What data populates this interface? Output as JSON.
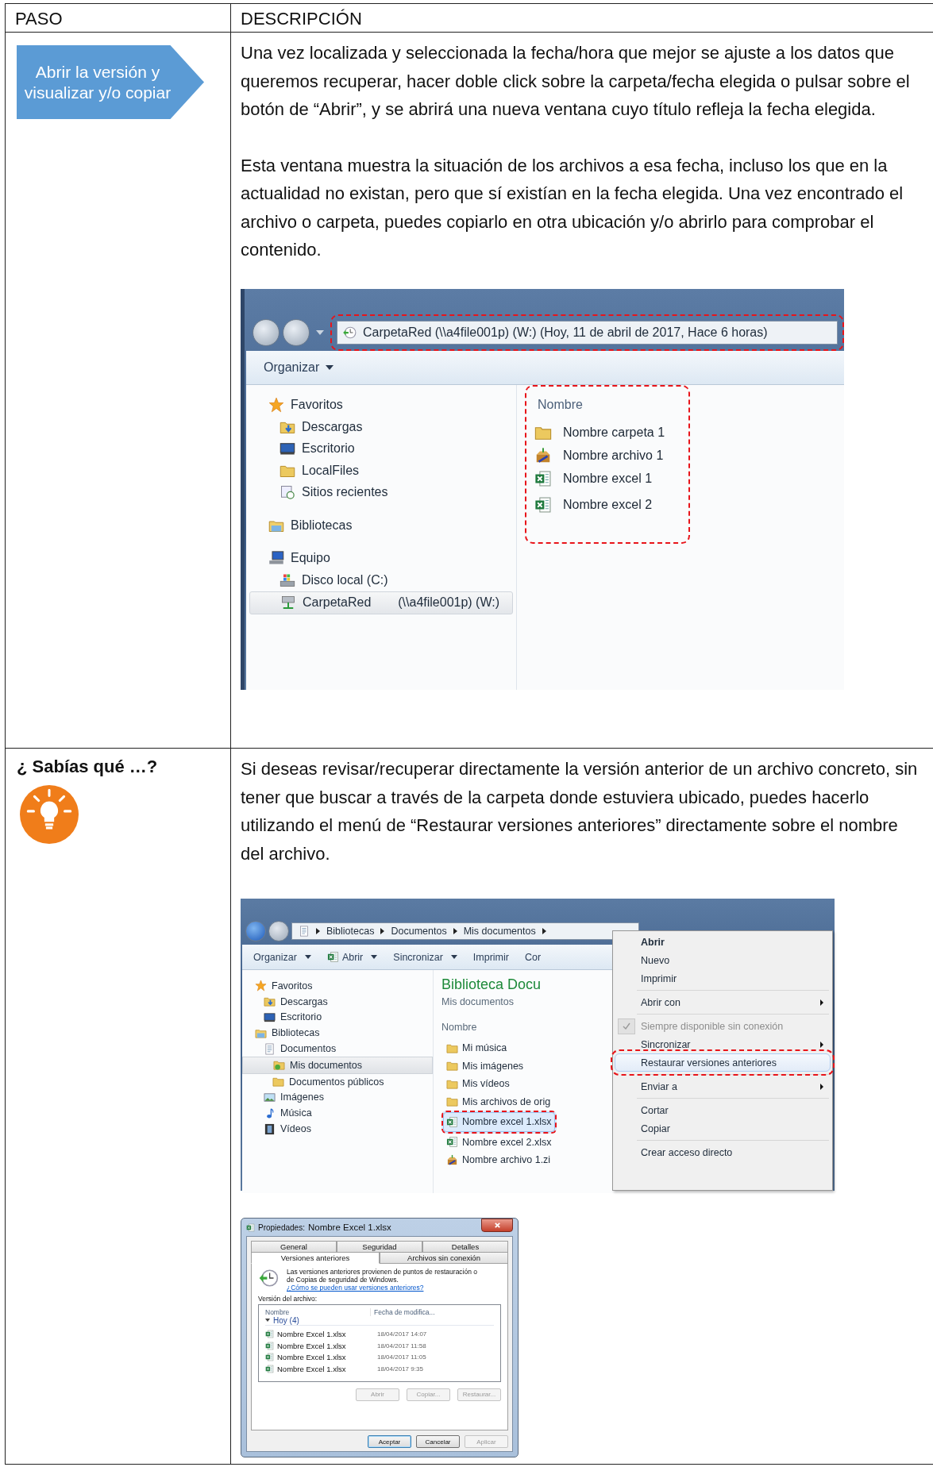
{
  "table": {
    "columns": [
      {
        "label": "PASO"
      },
      {
        "label": "DESCRIPCIÓN"
      }
    ],
    "rows": [
      {
        "step": {
          "kind": "arrow",
          "label": "Abrir la versión y visualizar y/o copiar"
        },
        "paragraphs": [
          "Una vez localizada y seleccionada la fecha/hora que mejor se ajuste a los datos que queremos recuperar, hacer doble click sobre la carpeta/fecha elegida o pulsar sobre el botón de “Abrir”, y se abrirá una nueva ventana cuyo título refleja la fecha elegida.",
          "Esta ventana muestra la situación de los archivos a esa fecha, incluso los que en la actualidad no existan, pero que sí existían en la fecha elegida. Una vez encontrado el archivo o carpeta, puedes copiarlo en otra ubicación y/o abrirlo para comprobar el contenido."
        ],
        "explorer": {
          "address": "CarpetaRed (\\\\a4file001p) (W:) (Hoy, 11 de abril de 2017, Hace 6 horas)",
          "address_highlighted": true,
          "toolbar": [
            {
              "label": "Organizar",
              "dropdown": true
            }
          ],
          "nav": [
            {
              "label": "Favoritos",
              "kind": "star",
              "selected": false,
              "children": [
                {
                  "label": "Descargas",
                  "kind": "downloads",
                  "selected": false
                },
                {
                  "label": "Escritorio",
                  "kind": "desktop",
                  "selected": false
                },
                {
                  "label": "LocalFiles",
                  "kind": "folder",
                  "selected": false
                },
                {
                  "label": "Sitios recientes",
                  "kind": "recent",
                  "selected": false
                }
              ]
            },
            {
              "label": "Bibliotecas",
              "kind": "library",
              "selected": false
            },
            {
              "label": "Equipo",
              "kind": "computer",
              "selected": false,
              "children": [
                {
                  "label": "Disco local (C:)",
                  "kind": "drive",
                  "selected": false
                },
                {
                  "label": "CarpetaRed",
                  "detail": "(\\\\a4file001p) (W:)",
                  "kind": "network",
                  "selected": true
                }
              ]
            }
          ],
          "column": "Nombre",
          "files_highlighted": true,
          "files": [
            {
              "label": "Nombre carpeta 1",
              "kind": "folder"
            },
            {
              "label": "Nombre archivo 1",
              "kind": "zip"
            },
            {
              "label": "Nombre excel 1",
              "kind": "excel"
            },
            {
              "label": "Nombre excel 2",
              "kind": "excel"
            }
          ]
        }
      },
      {
        "step": {
          "kind": "tip",
          "label": "¿ Sabías qué …?"
        },
        "paragraphs": [
          "Si deseas revisar/recuperar directamente la versión anterior de un archivo concreto, sin tener que buscar a través de la carpeta donde estuviera ubicado, puedes hacerlo utilizando el menú de “Restaurar versiones anteriores” directamente sobre el nombre del archivo."
        ],
        "library_explorer": {
          "breadcrumbs": [
            "Bibliotecas",
            "Documentos",
            "Mis documentos"
          ],
          "toolbar": [
            {
              "label": "Organizar",
              "kind": "text",
              "dropdown": true
            },
            {
              "label": "Abrir",
              "kind": "excel",
              "dropdown": true
            },
            {
              "label": "Sincronizar",
              "kind": "text",
              "dropdown": true
            },
            {
              "label": "Imprimir",
              "kind": "text",
              "dropdown": false
            },
            {
              "label": "Cor",
              "kind": "text",
              "dropdown": false
            }
          ],
          "nav": [
            {
              "label": "Favoritos",
              "kind": "star",
              "selected": false,
              "children": [
                {
                  "label": "Descargas",
                  "kind": "downloads",
                  "selected": false
                },
                {
                  "label": "Escritorio",
                  "kind": "desktop",
                  "selected": false
                }
              ]
            },
            {
              "label": "Bibliotecas",
              "kind": "library",
              "selected": false,
              "children": [
                {
                  "label": "Documentos",
                  "kind": "document",
                  "selected": false,
                  "children": [
                    {
                      "label": "Mis documentos",
                      "kind": "docfolder",
                      "selected": true
                    },
                    {
                      "label": "Documentos públicos",
                      "kind": "folder",
                      "selected": false
                    }
                  ]
                },
                {
                  "label": "Imágenes",
                  "kind": "pictures",
                  "selected": false
                },
                {
                  "label": "Música",
                  "kind": "music",
                  "selected": false
                },
                {
                  "label": "Vídeos",
                  "kind": "videos",
                  "selected": false
                }
              ]
            }
          ],
          "title": "Biblioteca Docu",
          "subtitle": "Mis documentos",
          "column": "Nombre",
          "files": [
            {
              "label": "Mi música",
              "kind": "folder",
              "selected": false,
              "highlighted": false
            },
            {
              "label": "Mis imágenes",
              "kind": "folder",
              "selected": false,
              "highlighted": false
            },
            {
              "label": "Mis vídeos",
              "kind": "folder",
              "selected": false,
              "highlighted": false
            },
            {
              "label": "Mis archivos de orig",
              "kind": "folder",
              "selected": false,
              "highlighted": false
            },
            {
              "label": "Nombre excel 1.xlsx",
              "kind": "excel",
              "selected": true,
              "highlighted": true
            },
            {
              "label": "Nombre excel 2.xlsx",
              "kind": "excel",
              "selected": false,
              "highlighted": false
            },
            {
              "label": "Nombre archivo 1.zi",
              "kind": "zip",
              "selected": false,
              "highlighted": false
            }
          ]
        },
        "context_menu": [
          {
            "kind": "item",
            "label": "Abrir",
            "default": true,
            "disabled": false,
            "checked": false,
            "submenu": false,
            "selected": false,
            "highlighted": false
          },
          {
            "kind": "item",
            "label": "Nuevo",
            "default": false,
            "disabled": false,
            "checked": false,
            "submenu": false,
            "selected": false,
            "highlighted": false
          },
          {
            "kind": "item",
            "label": "Imprimir",
            "default": false,
            "disabled": false,
            "checked": false,
            "submenu": false,
            "selected": false,
            "highlighted": false
          },
          {
            "kind": "separator"
          },
          {
            "kind": "item",
            "label": "Abrir con",
            "default": false,
            "disabled": false,
            "checked": false,
            "submenu": true,
            "selected": false,
            "highlighted": false
          },
          {
            "kind": "separator"
          },
          {
            "kind": "item",
            "label": "Siempre disponible sin conexión",
            "default": false,
            "disabled": true,
            "checked": true,
            "submenu": false,
            "selected": false,
            "highlighted": false
          },
          {
            "kind": "item",
            "label": "Sincronizar",
            "default": false,
            "disabled": false,
            "checked": false,
            "submenu": true,
            "selected": false,
            "highlighted": false
          },
          {
            "kind": "item",
            "label": "Restaurar versiones anteriores",
            "default": false,
            "disabled": false,
            "checked": false,
            "submenu": false,
            "selected": true,
            "highlighted": true
          },
          {
            "kind": "separator"
          },
          {
            "kind": "item",
            "label": "Enviar a",
            "default": false,
            "disabled": false,
            "checked": false,
            "submenu": true,
            "selected": false,
            "highlighted": false
          },
          {
            "kind": "separator"
          },
          {
            "kind": "item",
            "label": "Cortar",
            "default": false,
            "disabled": false,
            "checked": false,
            "submenu": false,
            "selected": false,
            "highlighted": false
          },
          {
            "kind": "item",
            "label": "Copiar",
            "default": false,
            "disabled": false,
            "checked": false,
            "submenu": false,
            "selected": false,
            "highlighted": false
          },
          {
            "kind": "separator"
          },
          {
            "kind": "item",
            "label": "Crear acceso directo",
            "default": false,
            "disabled": false,
            "checked": false,
            "submenu": false,
            "selected": false,
            "highlighted": false
          }
        ],
        "properties_dialog": {
          "title_label": "Propiedades:",
          "title_file": "Nombre Excel 1.xlsx",
          "tabs": [
            [
              {
                "label": "General",
                "selected": false
              },
              {
                "label": "Seguridad",
                "selected": false
              },
              {
                "label": "Detalles",
                "selected": false
              }
            ],
            [
              {
                "label": "Versiones anteriores",
                "selected": true
              },
              {
                "label": "Archivos sin conexión",
                "selected": false
              }
            ]
          ],
          "info": "Las versiones anteriores provienen de puntos de restauración o de Copias de seguridad de Windows.",
          "link": "¿Cómo se pueden usar versiones anteriores?",
          "list_label": "Versión del archivo:",
          "columns": [
            "Nombre",
            "Fecha de modifica..."
          ],
          "groups": [
            {
              "label": "Hoy (4)",
              "expanded": true,
              "rows": [
                {
                  "name": "Nombre Excel 1.xlsx",
                  "date": "18/04/2017 14:07"
                },
                {
                  "name": "Nombre Excel 1.xlsx",
                  "date": "18/04/2017 11:58"
                },
                {
                  "name": "Nombre Excel 1.xlsx",
                  "date": "18/04/2017 11:05"
                },
                {
                  "name": "Nombre Excel 1.xlsx",
                  "date": "18/04/2017 9:35"
                }
              ]
            }
          ],
          "actions": [
            {
              "label": "Abrir",
              "disabled": true
            },
            {
              "label": "Copiar...",
              "disabled": true
            },
            {
              "label": "Restaurar...",
              "disabled": true
            }
          ],
          "buttons": [
            {
              "label": "Aceptar",
              "default": true,
              "disabled": false
            },
            {
              "label": "Cancelar",
              "default": false,
              "disabled": false
            },
            {
              "label": "Aplicar",
              "default": false,
              "disabled": true
            }
          ]
        }
      }
    ]
  }
}
